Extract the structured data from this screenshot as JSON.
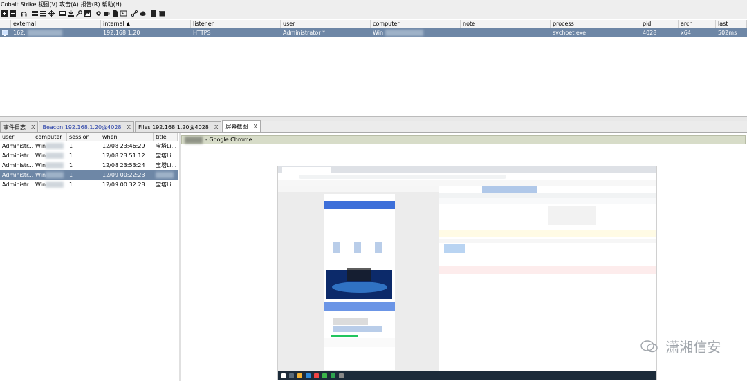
{
  "menu": [
    "Cobalt Strike",
    "视图(V)",
    "攻击(A)",
    "报告(R)",
    "帮助(H)"
  ],
  "toolbar_icons": [
    "plus-icon",
    "minus-icon",
    "headphones-icon",
    "targets-icon",
    "list-icon",
    "crosshair-icon",
    "image-icon",
    "download-icon",
    "key-icon",
    "picture-icon",
    "gear-icon",
    "coffee-icon",
    "file-icon",
    "terminal-icon",
    "link-icon",
    "cloud-icon",
    "book-icon",
    "box-icon"
  ],
  "beacons": {
    "columns": [
      "external",
      "internal ▲",
      "listener",
      "user",
      "computer",
      "note",
      "process",
      "pid",
      "arch",
      "last"
    ],
    "rows": [
      {
        "external": "162.",
        "internal": "192.168.1.20",
        "listener": "HTTPS",
        "user": "Administrator *",
        "computer": "Win",
        "note": "",
        "process": "svchoet.exe",
        "pid": "4028",
        "arch": "x64",
        "last": "502ms"
      }
    ]
  },
  "tabs": [
    {
      "label": "事件日志",
      "close": "X"
    },
    {
      "label": "Beacon 192.168.1.20@4028",
      "close": "X"
    },
    {
      "label": "Files 192.168.1.20@4028",
      "close": "X"
    },
    {
      "label": "屏幕截图",
      "close": "X"
    }
  ],
  "screenshots": {
    "columns": [
      "user",
      "computer",
      "session",
      "when",
      "title"
    ],
    "rows": [
      {
        "user": "Administr...",
        "computer": "Win",
        "session": "1",
        "when": "12/08 23:46:29",
        "title": "宝塔Li..."
      },
      {
        "user": "Administr...",
        "computer": "Win",
        "session": "1",
        "when": "12/08 23:51:12",
        "title": "宝塔Li..."
      },
      {
        "user": "Administr...",
        "computer": "Win",
        "session": "1",
        "when": "12/08 23:53:24",
        "title": "宝塔Li..."
      },
      {
        "user": "Administr...",
        "computer": "Win",
        "session": "1",
        "when": "12/09 00:22:23",
        "title": ""
      },
      {
        "user": "Administr...",
        "computer": "Win",
        "session": "1",
        "when": "12/09 00:32:28",
        "title": "宝塔Li..."
      }
    ]
  },
  "preview": {
    "title": "- Google Chrome",
    "watermark": "潇湘信安"
  }
}
